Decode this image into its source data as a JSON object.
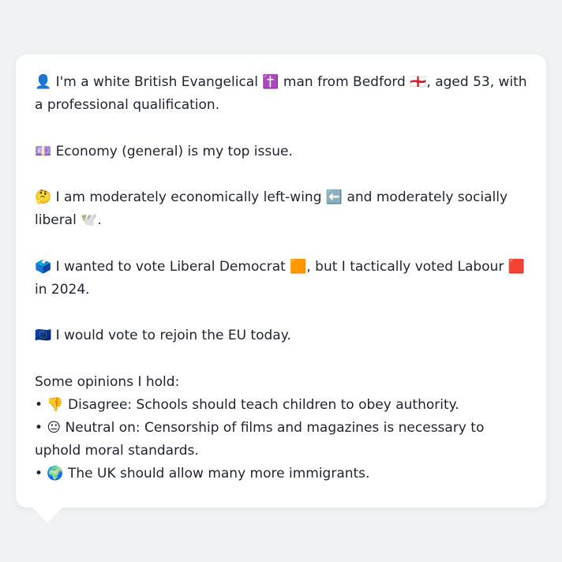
{
  "profile": {
    "intro": "👤 I'm a white British Evangelical ✝️ man from Bedford 🏴󠁧󠁢󠁥󠁮󠁧󠁿, aged 53, with a professional qualification.",
    "top_issue": "💷 Economy (general) is my top issue.",
    "ideology": "🤔 I am moderately economically left-wing ⬅️ and moderately socially liberal 🕊️.",
    "vote": "🗳️ I wanted to vote Liberal Democrat 🟧, but I tactically voted Labour 🟥 in 2024.",
    "eu": "🇪🇺 I would vote to rejoin the EU today.",
    "opinions_heading": "Some opinions I hold:",
    "opinions": [
      "• 👎 Disagree: Schools should teach children to obey authority.",
      "• 😐 Neutral on: Censorship of films and magazines is necessary to uphold moral standards.",
      "• 🌍 The UK should allow many more immigrants."
    ]
  }
}
